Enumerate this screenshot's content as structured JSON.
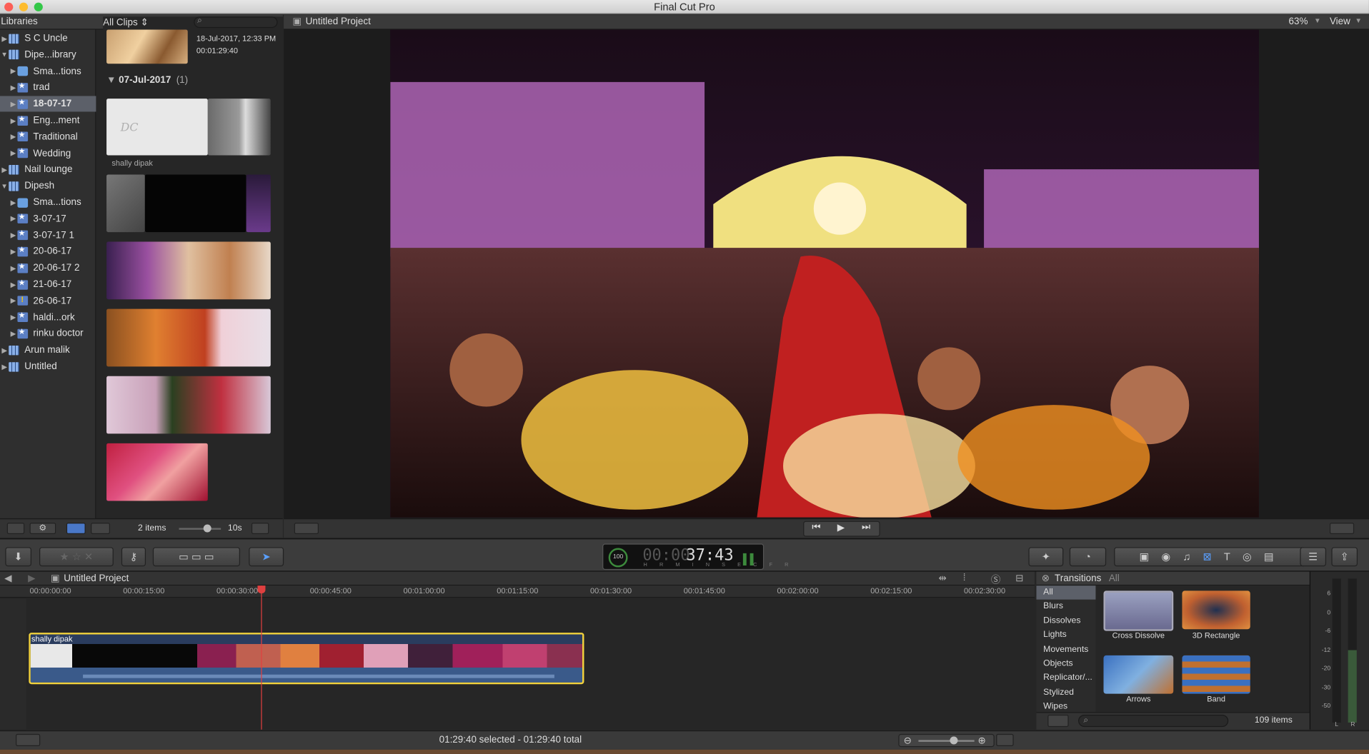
{
  "window": {
    "title": "Final Cut Pro"
  },
  "browser": {
    "libraries_label": "Libraries",
    "filter_label": "All Clips",
    "libraries": [
      {
        "label": "S C Uncle",
        "kind": "library",
        "expanded": false
      },
      {
        "label": "Dipe...ibrary",
        "kind": "library",
        "expanded": true
      },
      {
        "label": "Sma...tions",
        "kind": "folder"
      },
      {
        "label": "trad",
        "kind": "event"
      },
      {
        "label": "18-07-17",
        "kind": "event",
        "selected": true
      },
      {
        "label": "Eng...ment",
        "kind": "event"
      },
      {
        "label": "Traditional",
        "kind": "event"
      },
      {
        "label": "Wedding",
        "kind": "event"
      },
      {
        "label": "Nail lounge",
        "kind": "library",
        "expanded": false
      },
      {
        "label": "Dipesh",
        "kind": "library",
        "expanded": true
      },
      {
        "label": "Sma...tions",
        "kind": "folder"
      },
      {
        "label": "3-07-17",
        "kind": "event"
      },
      {
        "label": "3-07-17 1",
        "kind": "event"
      },
      {
        "label": "20-06-17",
        "kind": "event"
      },
      {
        "label": "20-06-17 2",
        "kind": "event"
      },
      {
        "label": "21-06-17",
        "kind": "event"
      },
      {
        "label": "26-06-17",
        "kind": "event-warning"
      },
      {
        "label": "haldi...ork",
        "kind": "event"
      },
      {
        "label": "rinku doctor",
        "kind": "event"
      },
      {
        "label": "Arun malik",
        "kind": "library",
        "expanded": false
      },
      {
        "label": "Untitled",
        "kind": "library",
        "expanded": false
      }
    ],
    "clip_date": "18-Jul-2017, 12:33 PM",
    "clip_duration": "00:01:29:40",
    "group_date": "07-Jul-2017",
    "group_count": "(1)",
    "clip_name": "shally dipak",
    "items_count": "2 items",
    "zoom_label": "10s"
  },
  "viewer": {
    "project_title": "Untitled Project",
    "zoom": "63%",
    "view_label": "View"
  },
  "toolbar": {
    "timecode": "00:00:37:43",
    "timecode_dim": "00:00",
    "timecode_bright": "37:43",
    "tc_units": [
      "HR",
      "MIN",
      "SEC",
      "FR"
    ],
    "progress_label": "100"
  },
  "timeline": {
    "project_title": "Untitled Project",
    "ruler": [
      "00:00:00:00",
      "00:00:15:00",
      "00:00:30:00",
      "00:00:45:00",
      "00:01:00:00",
      "00:01:15:00",
      "00:01:30:00",
      "00:01:45:00",
      "00:02:00:00",
      "00:02:15:00",
      "00:02:30:00"
    ],
    "clip_name": "shally dipak"
  },
  "transitions": {
    "title": "Transitions",
    "filter": "All",
    "categories": [
      "All",
      "Blurs",
      "Dissolves",
      "Lights",
      "Movements",
      "Objects",
      "Replicator/...",
      "Stylized",
      "Wipes"
    ],
    "items": [
      "Cross Dissolve",
      "3D Rectangle",
      "Arrows",
      "Band"
    ],
    "count": "109 items"
  },
  "meters": {
    "scale": [
      "6",
      "0",
      "-6",
      "-12",
      "-20",
      "-30",
      "-50"
    ],
    "channels": [
      "L",
      "R"
    ]
  },
  "status": {
    "selection": "01:29:40 selected - 01:29:40 total"
  }
}
